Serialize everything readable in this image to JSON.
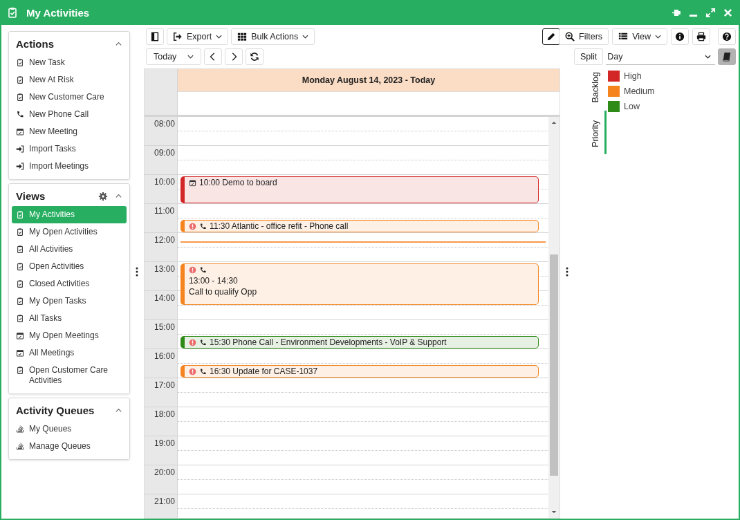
{
  "window": {
    "title": "My Activities"
  },
  "sidebar": [
    {
      "title": "Actions",
      "settings": false,
      "expanded": true,
      "items": [
        {
          "label": "New Task",
          "kind": "task",
          "selected": false
        },
        {
          "label": "New At Risk",
          "kind": "task",
          "selected": false
        },
        {
          "label": "New Customer Care",
          "kind": "task",
          "selected": false
        },
        {
          "label": "New Phone Call",
          "kind": "phone",
          "selected": false
        },
        {
          "label": "New Meeting",
          "kind": "meeting",
          "selected": false
        },
        {
          "label": "Import Tasks",
          "kind": "import",
          "selected": false
        },
        {
          "label": "Import Meetings",
          "kind": "import",
          "selected": false
        }
      ]
    },
    {
      "title": "Views",
      "settings": true,
      "expanded": true,
      "items": [
        {
          "label": "My Activities",
          "kind": "task",
          "selected": true
        },
        {
          "label": "My Open Activities",
          "kind": "task",
          "selected": false
        },
        {
          "label": "All Activities",
          "kind": "task",
          "selected": false
        },
        {
          "label": "Open Activities",
          "kind": "task",
          "selected": false
        },
        {
          "label": "Closed Activities",
          "kind": "task",
          "selected": false
        },
        {
          "label": "My Open Tasks",
          "kind": "task",
          "selected": false
        },
        {
          "label": "All Tasks",
          "kind": "task",
          "selected": false
        },
        {
          "label": "My Open Meetings",
          "kind": "meeting",
          "selected": false
        },
        {
          "label": "All Meetings",
          "kind": "meeting",
          "selected": false
        },
        {
          "label": "Open Customer Care Activities",
          "kind": "task",
          "selected": false
        }
      ]
    },
    {
      "title": "Activity Queues",
      "settings": false,
      "expanded": true,
      "items": [
        {
          "label": "My Queues",
          "kind": "queue",
          "selected": false
        },
        {
          "label": "Manage Queues",
          "kind": "queue",
          "selected": false
        }
      ]
    }
  ],
  "toolbar": {
    "export": "Export",
    "bulk_actions": "Bulk Actions",
    "filters": "Filters",
    "view": "View",
    "edit_active": true
  },
  "navigation": {
    "range": "Today"
  },
  "calendar": {
    "date_header": "Monday August 14, 2023 - Today",
    "hours": [
      "08:00",
      "09:00",
      "10:00",
      "11:00",
      "12:00",
      "13:00",
      "14:00",
      "15:00",
      "16:00",
      "17:00",
      "18:00",
      "19:00",
      "20:00",
      "21:00"
    ],
    "events": [
      {
        "kind": "meeting",
        "alert": false,
        "time": "10:00",
        "title": "Demo to board",
        "color": "#d32626"
      },
      {
        "kind": "call",
        "alert": true,
        "time": "11:30",
        "title": "Atlantic - office refit - Phone call",
        "color": "#f5841f"
      },
      {
        "kind": "call",
        "alert": true,
        "time": "13:00 - 14:30",
        "title": "Call to qualify Opp",
        "color": "#f5841f"
      },
      {
        "kind": "call",
        "alert": true,
        "time": "15:30",
        "title": "Phone Call - Environment Developments - VoIP & Support",
        "color": "#2e8b17"
      },
      {
        "kind": "call",
        "alert": true,
        "time": "16:30",
        "title": "Update for CASE-1037",
        "color": "#f5841f"
      }
    ]
  },
  "right_panel": {
    "split": "Split",
    "mode": "Day",
    "tabs": [
      {
        "label": "Backlog",
        "selected": false
      },
      {
        "label": "Priority",
        "selected": true
      }
    ],
    "legend": [
      {
        "label": "High",
        "color": "#d32626"
      },
      {
        "label": "Medium",
        "color": "#f5841f"
      },
      {
        "label": "Low",
        "color": "#2e8b17"
      }
    ]
  }
}
